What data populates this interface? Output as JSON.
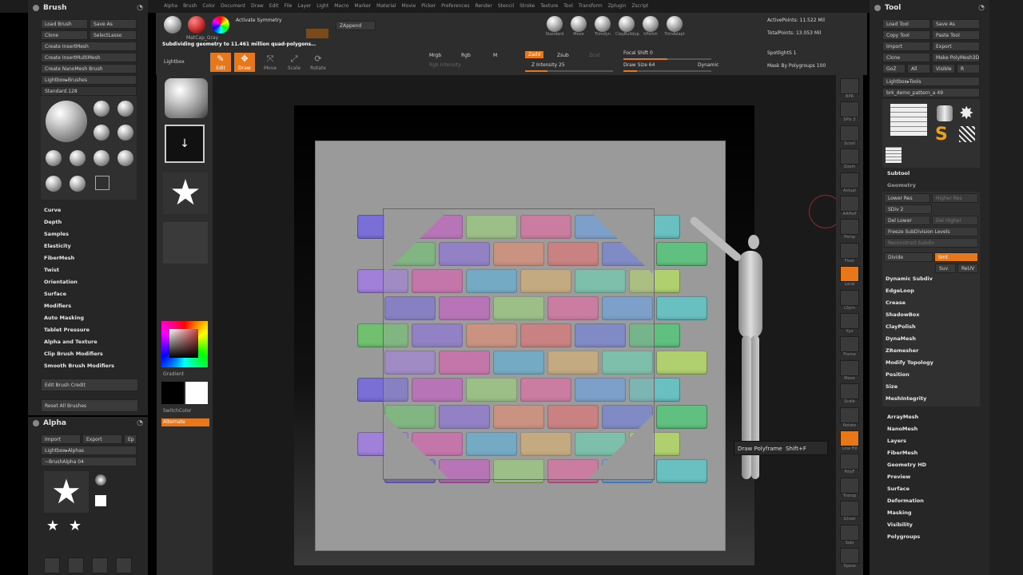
{
  "top_menu": [
    "Alpha",
    "Brush",
    "Color",
    "Document",
    "Draw",
    "Edit",
    "File",
    "Layer",
    "Light",
    "Macro",
    "Marker",
    "Material",
    "Movie",
    "Picker",
    "Preferences",
    "Render",
    "Stencil",
    "Stroke",
    "Texture",
    "Tool",
    "Transform",
    "Zplugin",
    "Zscript"
  ],
  "toolbar": {
    "material_label": "MatCap_Gray",
    "activate_symmetry": "Activate Symmetry",
    "zappend": "ZAppend",
    "status_message": "Subdividing geometry to 11.461 million quad-polygons…",
    "lightbox": "Lightbox",
    "edit": "Edit",
    "draw": "Draw",
    "move": "Move",
    "scale": "Scale",
    "rotate": "Rotate",
    "mrgb": "Mrgb",
    "rgb": "Rgb",
    "m": "M",
    "zadd": "Zadd",
    "zsub": "Zsub",
    "zcut": "Zcut",
    "z_intensity": "Z Intensity 25",
    "rgb_intensity": "Rgb Intensity",
    "focal_shift": "Focal Shift 0",
    "draw_size": "Draw Size 64",
    "dynamic": "Dynamic",
    "active_points": "ActivePoints: 11.522 Mil",
    "total_points": "TotalPoints: 13.053 Mil",
    "spotlight": "SpotlightS 1",
    "mask_by_polygroups": "Mask By Polygroups 100",
    "brush_shelf": [
      "Standard",
      "Move",
      "Trimdyn",
      "ClayBuildup",
      "hPolish",
      "TrimAdapt"
    ]
  },
  "brush_panel": {
    "title": "Brush",
    "buttons": [
      [
        "Load Brush",
        "Save As"
      ],
      [
        "Clone",
        "SelectLasso"
      ]
    ],
    "list": [
      "Create InsertMesh",
      "Create InsertMultiMesh",
      "Create NanoMesh Brush",
      "Lightbox▸Brushes"
    ],
    "slider": "Standard.128",
    "submenus": [
      "Curve",
      "Depth",
      "Samples",
      "Elasticity",
      "FiberMesh",
      "Twist",
      "Orientation",
      "Surface",
      "Modifiers",
      "Auto Masking",
      "Tablet Pressure",
      "Alpha and Texture",
      "Clip Brush Modifiers",
      "Smooth Brush Modifiers"
    ],
    "edit_credit": "Edit Brush Credit",
    "reset": "Reset All Brushes"
  },
  "alpha_panel": {
    "title": "Alpha",
    "buttons": [
      "Import",
      "Export",
      "Ep"
    ],
    "lightbox": "Lightbox▸Alphas",
    "slider": "~BrushAlpha 04"
  },
  "left_shelf": {
    "gradient": "Gradient",
    "switch_color": "SwitchColor",
    "alternate": "Alternate"
  },
  "tool_panel": {
    "title": "Tool",
    "buttons": [
      [
        "Load Tool",
        "Save As"
      ],
      [
        "Copy Tool",
        "Paste Tool"
      ],
      [
        "Import",
        "Export"
      ],
      [
        "Clone",
        "Make PolyMesh3D"
      ],
      [
        "GoZ",
        "All",
        "Visible",
        "R"
      ]
    ],
    "lightbox": "Lightbox▸Tools",
    "slider": "brk_demo_pattern_a  49",
    "subtools_label": "Subtool",
    "geometry_label": "Geometry",
    "lower_res": "Lower Res",
    "higher_res": "Higher Res",
    "sdiv": "SDiv 2",
    "del_lower": "Del Lower",
    "del_higher": "Del Higher",
    "freeze": "Freeze SubDivision Levels",
    "reconstruct": "Reconstruct Subdiv",
    "divide": "Divide",
    "smt": "Smt",
    "suv": "Suv",
    "relax": "ReUV",
    "menu_items": [
      "Dynamic Subdiv",
      "EdgeLoop",
      "Crease",
      "ShadowBox",
      "ClayPolish",
      "DynaMesh",
      "ZRemesher",
      "Modify Topology",
      "Position",
      "Size",
      "MeshIntegrity"
    ],
    "lower_items": [
      "ArrayMesh",
      "NanoMesh",
      "Layers",
      "FiberMesh",
      "Geometry HD",
      "Preview",
      "Surface",
      "Deformation",
      "Masking",
      "Visibility",
      "Polygroups"
    ]
  },
  "right_shelf": [
    "BPR",
    "SPix 3",
    "Scroll",
    "Zoom",
    "Actual",
    "AAHalf",
    "Persp",
    "Floor",
    "Local",
    "LSym",
    "Xyz",
    "Frame",
    "Move",
    "Scale",
    "Rotate",
    "Line Fill",
    "PolyF",
    "Transp",
    "Ghost",
    "Solo",
    "Xpose"
  ],
  "tooltip": {
    "label": "Draw Polyframe",
    "shortcut": "Shift+F"
  },
  "brick_colors": [
    "#7a6fd6",
    "#c45fc4",
    "#9ad07a",
    "#e06aa0",
    "#6aa0e0",
    "#6ac0c0",
    "#70c070",
    "#8a70d8",
    "#e08a70",
    "#e07070",
    "#6f7fd8",
    "#60c080",
    "#a080d8",
    "#d860b0",
    "#5fb0d8",
    "#d8b070",
    "#6ad0b0",
    "#b0d070"
  ]
}
